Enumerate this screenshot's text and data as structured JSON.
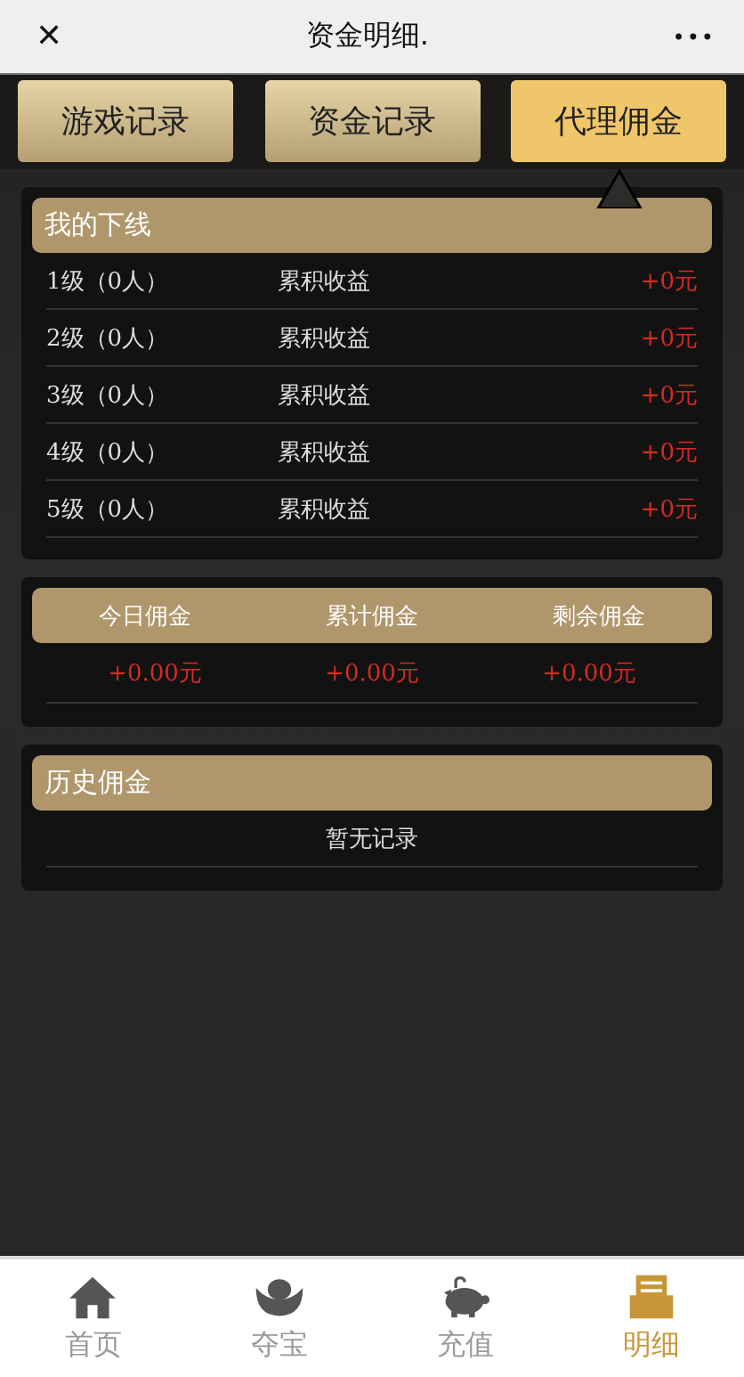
{
  "title_bar": {
    "close": "✕",
    "title": "资金明细.",
    "more": "•••"
  },
  "tabs": [
    {
      "label": "游戏记录",
      "selected": false
    },
    {
      "label": "资金记录",
      "selected": false
    },
    {
      "label": "代理佣金",
      "selected": true
    }
  ],
  "downline": {
    "title": "我的下线",
    "rows": [
      {
        "level": "1级（0人）",
        "label": "累积收益",
        "amount": "+0元"
      },
      {
        "level": "2级（0人）",
        "label": "累积收益",
        "amount": "+0元"
      },
      {
        "level": "3级（0人）",
        "label": "累积收益",
        "amount": "+0元"
      },
      {
        "level": "4级（0人）",
        "label": "累积收益",
        "amount": "+0元"
      },
      {
        "level": "5级（0人）",
        "label": "累积收益",
        "amount": "+0元"
      }
    ]
  },
  "commission": {
    "columns": [
      "今日佣金",
      "累计佣金",
      "剩余佣金"
    ],
    "values": [
      "+0.00元",
      "+0.00元",
      "+0.00元"
    ]
  },
  "history": {
    "title": "历史佣金",
    "empty": "暂无记录"
  },
  "nav": [
    {
      "label": "首页",
      "selected": false
    },
    {
      "label": "夺宝",
      "selected": false
    },
    {
      "label": "充值",
      "selected": false
    },
    {
      "label": "明细",
      "selected": true
    }
  ]
}
